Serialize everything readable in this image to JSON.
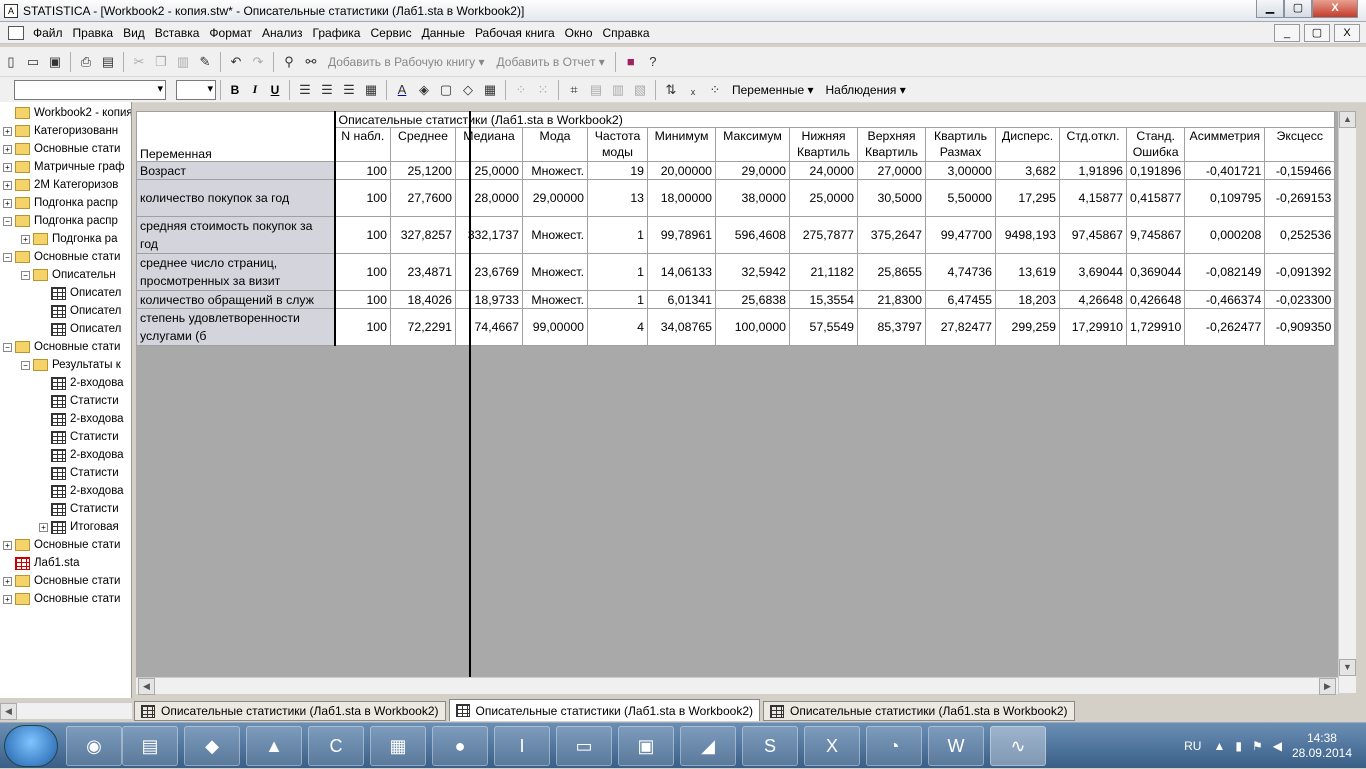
{
  "window": {
    "title": "STATISTICA - [Workbook2 - копия.stw* - Описательные статистики (Лаб1.sta в Workbook2)]",
    "min": "▁",
    "max": "▢",
    "close": "X"
  },
  "menu": [
    "Файл",
    "Правка",
    "Вид",
    "Вставка",
    "Формат",
    "Анализ",
    "Графика",
    "Сервис",
    "Данные",
    "Рабочая книга",
    "Окно",
    "Справка"
  ],
  "mdi": [
    "_",
    "▢",
    "X"
  ],
  "toolbar1": {
    "add_workbook": "Добавить в Рабочую книгу ▾",
    "add_report": "Добавить в Отчет ▾"
  },
  "toolbar2": {
    "font_value": "",
    "size_value": "",
    "bold": "B",
    "italic": "I",
    "underline": "U",
    "variables": "Переменные ▾",
    "cases": "Наблюдения ▾"
  },
  "tree": [
    {
      "label": "Workbook2 - копия.",
      "depth": 0,
      "type": "folder",
      "pm": ""
    },
    {
      "label": "Категоризованн",
      "depth": 0,
      "type": "folder",
      "pm": "+"
    },
    {
      "label": "Основные стати",
      "depth": 0,
      "type": "folder",
      "pm": "+"
    },
    {
      "label": "Матричные граф",
      "depth": 0,
      "type": "folder",
      "pm": "+"
    },
    {
      "label": "2М Категоризов",
      "depth": 0,
      "type": "folder",
      "pm": "+"
    },
    {
      "label": "Подгонка распр",
      "depth": 0,
      "type": "folder",
      "pm": "+"
    },
    {
      "label": "Подгонка распр",
      "depth": 0,
      "type": "folder",
      "pm": "−"
    },
    {
      "label": "Подгонка ра",
      "depth": 1,
      "type": "folder",
      "pm": "+"
    },
    {
      "label": "Основные стати",
      "depth": 0,
      "type": "folder",
      "pm": "−"
    },
    {
      "label": "Описательн",
      "depth": 1,
      "type": "folder",
      "pm": "−"
    },
    {
      "label": "Описател",
      "depth": 2,
      "type": "sheet",
      "pm": ""
    },
    {
      "label": "Описател",
      "depth": 2,
      "type": "sheet",
      "pm": ""
    },
    {
      "label": "Описател",
      "depth": 2,
      "type": "sheet",
      "pm": ""
    },
    {
      "label": "Основные стати",
      "depth": 0,
      "type": "folder",
      "pm": "−"
    },
    {
      "label": "Результаты к",
      "depth": 1,
      "type": "folder",
      "pm": "−"
    },
    {
      "label": "2-входова",
      "depth": 2,
      "type": "sheet",
      "pm": ""
    },
    {
      "label": "Статисти",
      "depth": 2,
      "type": "sheet",
      "pm": ""
    },
    {
      "label": "2-входова",
      "depth": 2,
      "type": "sheet",
      "pm": ""
    },
    {
      "label": "Статисти",
      "depth": 2,
      "type": "sheet",
      "pm": ""
    },
    {
      "label": "2-входова",
      "depth": 2,
      "type": "sheet",
      "pm": ""
    },
    {
      "label": "Статисти",
      "depth": 2,
      "type": "sheet",
      "pm": ""
    },
    {
      "label": "2-входова",
      "depth": 2,
      "type": "sheet",
      "pm": ""
    },
    {
      "label": "Статисти",
      "depth": 2,
      "type": "sheet",
      "pm": ""
    },
    {
      "label": "Итоговая",
      "depth": 2,
      "type": "sheet",
      "pm": "+"
    },
    {
      "label": "Основные стати",
      "depth": 0,
      "type": "folder",
      "pm": "+"
    },
    {
      "label": "Лаб1.sta",
      "depth": 0,
      "type": "redsheet",
      "pm": ""
    },
    {
      "label": "Основные стати",
      "depth": 0,
      "type": "folder",
      "pm": "+"
    },
    {
      "label": "Основные стати",
      "depth": 0,
      "type": "folder",
      "pm": "+"
    }
  ],
  "table": {
    "caption": "Описательные статистики (Лаб1.sta в Workbook2)",
    "corner": "Переменная",
    "columns": [
      "N набл.",
      "Среднее",
      "Медиана",
      "Мода",
      "Частота моды",
      "Минимум",
      "Максимум",
      "Нижняя Квартиль",
      "Верхняя Квартиль",
      "Квартиль Размах",
      "Дисперс.",
      "Стд.откл.",
      "Станд. Ошибка",
      "Асимметрия",
      "Эксцесс"
    ],
    "rows": [
      {
        "name": "Возраст",
        "values": [
          "100",
          "25,1200",
          "25,0000",
          "Множест.",
          "19",
          "20,00000",
          "29,0000",
          "24,0000",
          "27,0000",
          "3,00000",
          "3,682",
          "1,91896",
          "0,191896",
          "-0,401721",
          "-0,159466"
        ]
      },
      {
        "name": "количество покупок за год",
        "values": [
          "100",
          "27,7600",
          "28,0000",
          "29,00000",
          "13",
          "18,00000",
          "38,0000",
          "25,0000",
          "30,5000",
          "5,50000",
          "17,295",
          "4,15877",
          "0,415877",
          "0,109795",
          "-0,269153"
        ]
      },
      {
        "name": "средняя стоимость покупок за год",
        "values": [
          "100",
          "327,8257",
          "332,1737",
          "Множест.",
          "1",
          "99,78961",
          "596,4608",
          "275,7877",
          "375,2647",
          "99,47700",
          "9498,193",
          "97,45867",
          "9,745867",
          "0,000208",
          "0,252536"
        ]
      },
      {
        "name": "среднее число страниц, просмотренных за визит",
        "values": [
          "100",
          "23,4871",
          "23,6769",
          "Множест.",
          "1",
          "14,06133",
          "32,5942",
          "21,1182",
          "25,8655",
          "4,74736",
          "13,619",
          "3,69044",
          "0,369044",
          "-0,082149",
          "-0,091392"
        ]
      },
      {
        "name": "количество обращений в служ",
        "values": [
          "100",
          "18,4026",
          "18,9733",
          "Множест.",
          "1",
          "6,01341",
          "25,6838",
          "15,3554",
          "21,8300",
          "6,47455",
          "18,203",
          "4,26648",
          "0,426648",
          "-0,466374",
          "-0,023300"
        ]
      },
      {
        "name": "степень удовлетворенности услугами (б",
        "values": [
          "100",
          "72,2291",
          "74,4667",
          "99,00000",
          "4",
          "34,08765",
          "100,0000",
          "57,5549",
          "85,3797",
          "27,82477",
          "299,259",
          "17,29910",
          "1,729910",
          "-0,262477",
          "-0,909350"
        ]
      }
    ]
  },
  "tabs": [
    "Описательные статистики (Лаб1.sta в Workbook2)",
    "Описательные статистики (Лаб1.sta в Workbook2)",
    "Описательные статистики (Лаб1.sta в Workbook2)"
  ],
  "taskbar": {
    "lang": "RU",
    "time": "14:38",
    "date": "28.09.2014"
  }
}
